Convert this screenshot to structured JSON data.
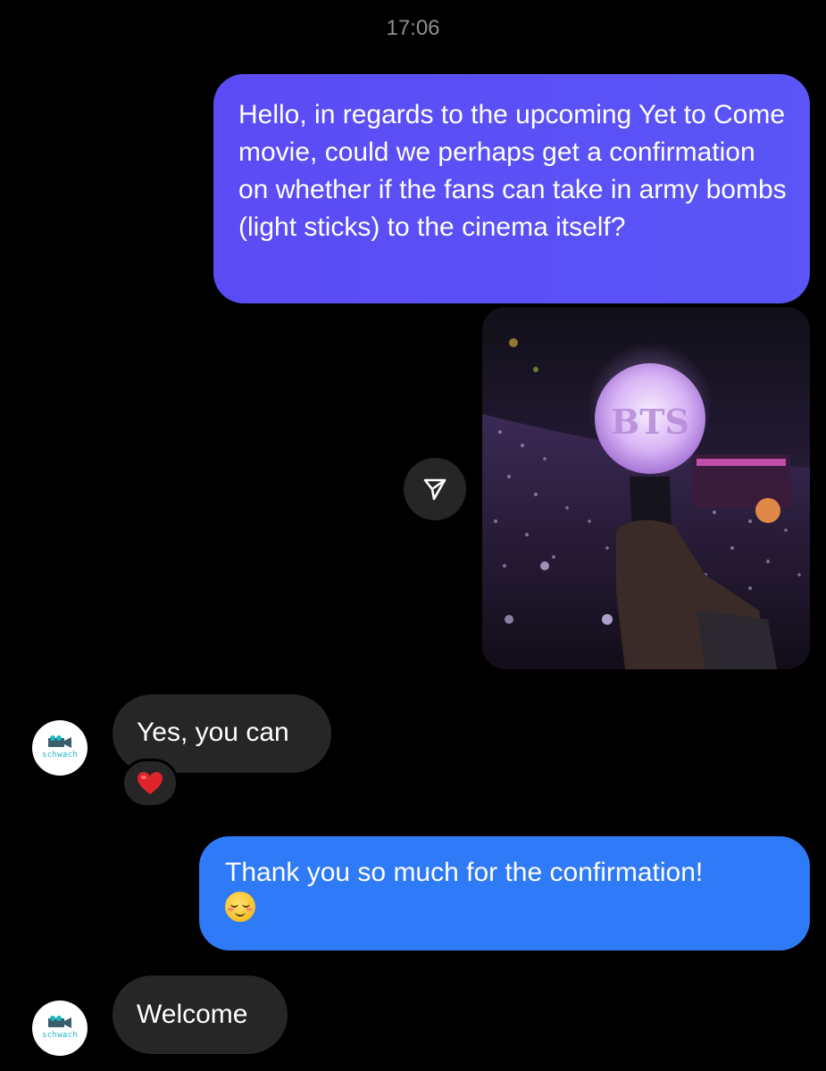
{
  "timestamp": "17:06",
  "messages": {
    "outgoing_1": "Hello, in regards to the upcoming Yet to Come movie, could we perhaps get a confirmation on whether if the fans can take in army bombs (light sticks) to the cinema itself?",
    "photo_text": "BTS",
    "incoming_1": "Yes, you can",
    "incoming_1_reaction": "heart-emoji",
    "outgoing_2": "Thank you so much for the confirmation!",
    "outgoing_2_emoji": "smiling-face-emoji",
    "incoming_2": "Welcome"
  },
  "avatar": {
    "logo_text": "schwach"
  },
  "colors": {
    "outgoing_bubble_1": "#5b4bf5",
    "outgoing_bubble_2": "#2f7af6",
    "incoming_bubble": "#262626",
    "background": "#000000"
  },
  "icons": {
    "share": "paper-plane-icon"
  }
}
